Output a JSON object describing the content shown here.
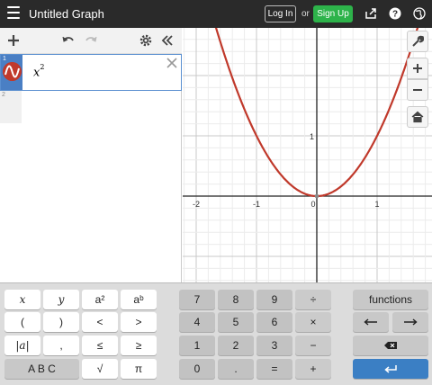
{
  "topbar": {
    "title": "Untitled Graph",
    "login_label": "Log In",
    "or_label": "or",
    "signup_label": "Sign Up"
  },
  "expressions": {
    "rows": [
      {
        "number": "1",
        "latex_base": "x",
        "latex_exp": "2",
        "color": "#c0392b"
      },
      {
        "number": "2"
      }
    ]
  },
  "graph": {
    "x_ticks": [
      "-2",
      "-1",
      "0",
      "1"
    ],
    "y_ticks": [
      "1"
    ],
    "curve_color": "#c0392b",
    "function": "x^2"
  },
  "keypad": {
    "fn_keys": [
      [
        "x",
        "y",
        "a²",
        "aᵇ"
      ],
      [
        "(",
        ")",
        "<",
        ">"
      ],
      [
        "|a|",
        ",",
        "≤",
        "≥"
      ],
      [
        "A B C",
        "√",
        "π"
      ]
    ],
    "num_keys": [
      [
        "7",
        "8",
        "9",
        "÷"
      ],
      [
        "4",
        "5",
        "6",
        "×"
      ],
      [
        "1",
        "2",
        "3",
        "−"
      ],
      [
        "0",
        ".",
        "=",
        "+"
      ]
    ],
    "functions_label": "functions"
  }
}
